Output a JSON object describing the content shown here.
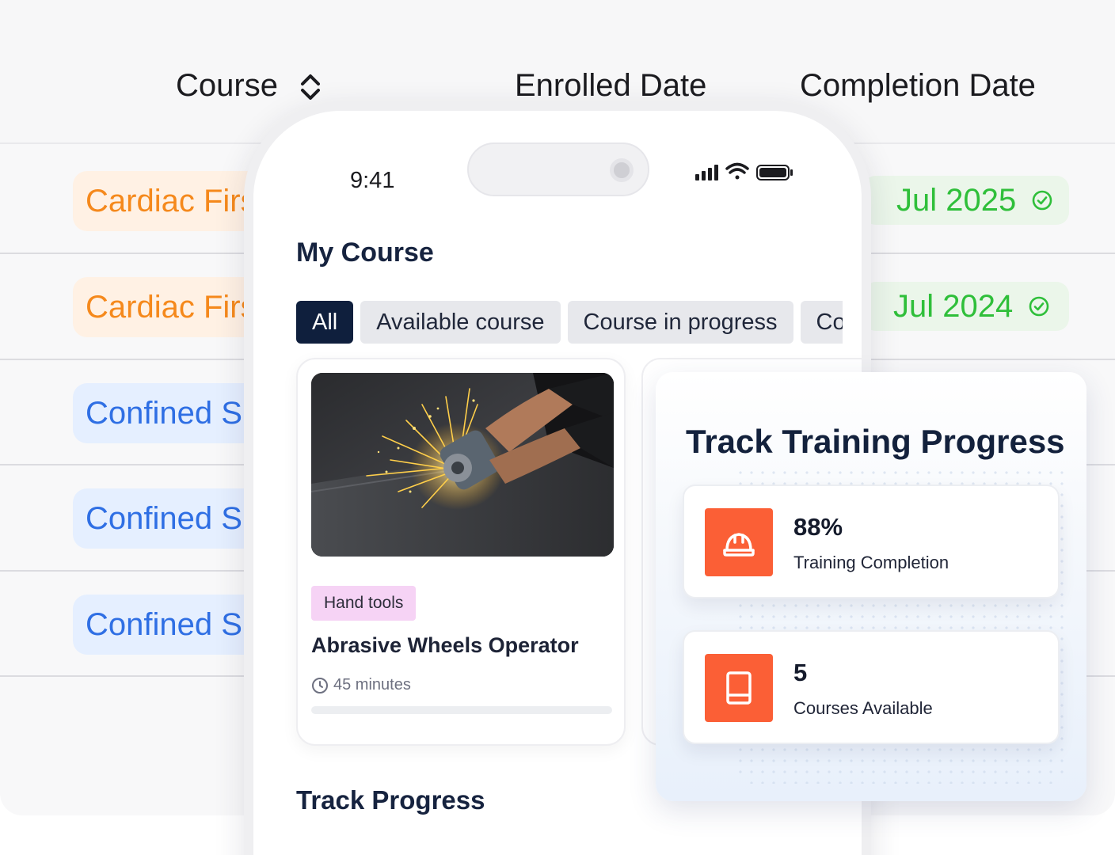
{
  "table": {
    "headers": {
      "course": "Course",
      "enrolled": "Enrolled Date",
      "completion": "Completion Date"
    },
    "rows": [
      {
        "course": "Cardiac First",
        "color": "orange",
        "completion": "Jul 2025"
      },
      {
        "course": "Cardiac First",
        "color": "orange",
        "completion": "Jul 2024"
      },
      {
        "course": "Confined Space",
        "color": "blue"
      },
      {
        "course": "Confined Space",
        "color": "blue"
      },
      {
        "course": "Confined Space",
        "color": "blue"
      }
    ],
    "colors": {
      "orange": "#f5891c",
      "blue": "#2f6fe4",
      "green": "#2fbf3a"
    }
  },
  "phone": {
    "time": "9:41",
    "section_title": "My Course",
    "tabs": [
      "All",
      "Available course",
      "Course in progress",
      "Course completed"
    ],
    "active_tab": "All",
    "course_card": {
      "tag": "Hand tools",
      "title": "Abrasive Wheels Operator",
      "duration": "45 minutes",
      "progress": 0
    },
    "bottom_title": "Track Progress"
  },
  "track_panel": {
    "title": "Track Training Progress",
    "stats": [
      {
        "value": "88%",
        "label": "Training Completion",
        "icon": "helmet-icon"
      },
      {
        "value": "5",
        "label": "Courses Available",
        "icon": "book-icon"
      }
    ],
    "accent": "#fb5f36"
  }
}
